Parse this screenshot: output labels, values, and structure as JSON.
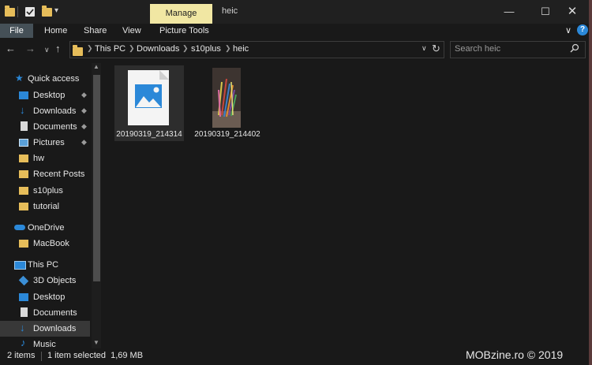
{
  "titlebar": {
    "contextual_tab": "Manage",
    "window_title": "heic",
    "controls": [
      "minimize",
      "maximize",
      "close"
    ]
  },
  "ribbon": {
    "tabs": [
      "File",
      "Home",
      "Share",
      "View",
      "Picture Tools"
    ]
  },
  "address": {
    "breadcrumbs": [
      "This PC",
      "Downloads",
      "s10plus",
      "heic"
    ],
    "search_placeholder": "Search heic"
  },
  "sidebar": {
    "quick_access": "Quick access",
    "items": [
      {
        "label": "Desktop",
        "icon": "desktop-icon",
        "pinned": true
      },
      {
        "label": "Downloads",
        "icon": "downloads-icon",
        "pinned": true
      },
      {
        "label": "Documents",
        "icon": "documents-icon",
        "pinned": true
      },
      {
        "label": "Pictures",
        "icon": "pictures-icon",
        "pinned": true
      },
      {
        "label": "hw",
        "icon": "folder-icon",
        "pinned": false
      },
      {
        "label": "Recent Posts",
        "icon": "folder-icon",
        "pinned": false
      },
      {
        "label": "s10plus",
        "icon": "folder-icon",
        "pinned": false
      },
      {
        "label": "tutorial",
        "icon": "folder-icon",
        "pinned": false
      }
    ],
    "onedrive": "OneDrive",
    "onedrive_items": [
      {
        "label": "MacBook",
        "icon": "folder-icon"
      }
    ],
    "this_pc": "This PC",
    "pc_items": [
      {
        "label": "3D Objects",
        "icon": "3d-objects-icon"
      },
      {
        "label": "Desktop",
        "icon": "desktop-icon"
      },
      {
        "label": "Documents",
        "icon": "documents-icon"
      },
      {
        "label": "Downloads",
        "icon": "downloads-icon",
        "selected": true
      },
      {
        "label": "Music",
        "icon": "music-icon"
      }
    ]
  },
  "files": [
    {
      "name": "20190319_214314",
      "thumb": "image-placeholder-icon",
      "selected": true
    },
    {
      "name": "20190319_214402",
      "thumb": "photo-thumbnail",
      "selected": false
    }
  ],
  "status": {
    "count": "2 items",
    "selection": "1 item selected  1,69 MB"
  },
  "watermark": "MOBzine.ro © 2019",
  "colors": {
    "background": "#191919",
    "titlebar": "#202020",
    "file_tab": "#455057",
    "manage_tab": "#f1e7a3",
    "folder": "#e6bd5a",
    "accent_blue": "#2b88d8",
    "selected": "#2d2d2d"
  }
}
